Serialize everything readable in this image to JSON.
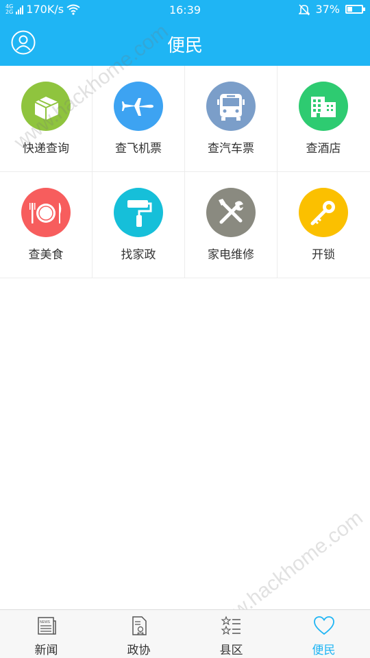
{
  "status_bar": {
    "network_top": "4G",
    "network_bottom": "2G",
    "speed": "170K/s",
    "time": "16:39",
    "battery": "37%",
    "battery_level": 0.37
  },
  "header": {
    "title": "便民"
  },
  "services": [
    {
      "label": "快递查询",
      "icon": "package-icon",
      "color": "#8fc43e"
    },
    {
      "label": "查飞机票",
      "icon": "airplane-icon",
      "color": "#3da3f2"
    },
    {
      "label": "查汽车票",
      "icon": "bus-icon",
      "color": "#7b9ec9"
    },
    {
      "label": "查酒店",
      "icon": "hotel-icon",
      "color": "#2ecb71"
    },
    {
      "label": "查美食",
      "icon": "dining-icon",
      "color": "#f75d5d"
    },
    {
      "label": "找家政",
      "icon": "paint-roller-icon",
      "color": "#16bfd9"
    },
    {
      "label": "家电维修",
      "icon": "repair-tools-icon",
      "color": "#8a8a80"
    },
    {
      "label": "开锁",
      "icon": "key-icon",
      "color": "#fbc000"
    }
  ],
  "tabs": [
    {
      "label": "新闻",
      "icon": "news-icon"
    },
    {
      "label": "政协",
      "icon": "document-icon"
    },
    {
      "label": "县区",
      "icon": "star-list-icon"
    },
    {
      "label": "便民",
      "icon": "heart-icon",
      "active": true
    }
  ],
  "watermark": "www.hackhome.com",
  "colors": {
    "primary": "#1fb5f4"
  }
}
